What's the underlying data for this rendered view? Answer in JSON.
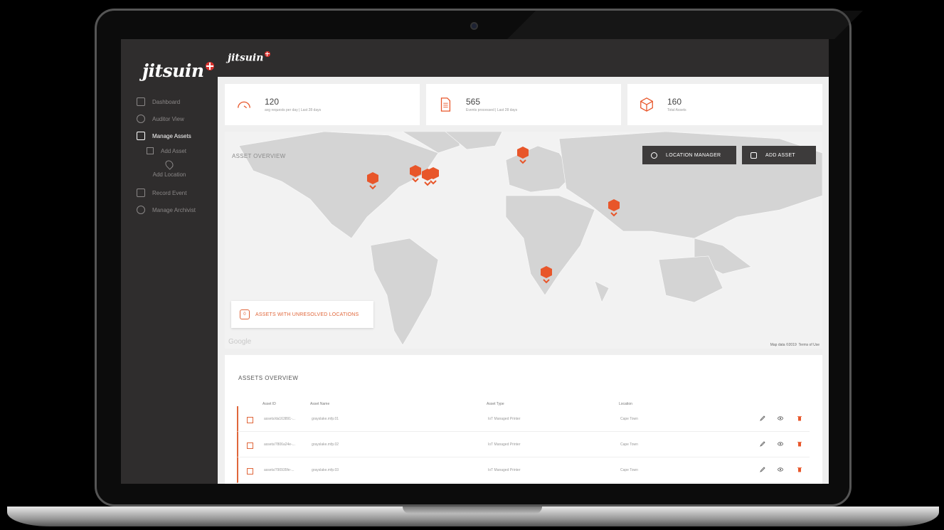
{
  "app": {
    "brand": "jitsuin"
  },
  "sidebar": {
    "items": [
      {
        "label": "Dashboard"
      },
      {
        "label": "Auditor View"
      },
      {
        "label": "Manage Assets"
      },
      {
        "label": "Add Asset"
      },
      {
        "label": "Add Location"
      },
      {
        "label": "Record Event"
      },
      {
        "label": "Manage Archivist"
      }
    ]
  },
  "stats": [
    {
      "value": "120",
      "label": "avg requests per day | Last 28 days",
      "icon": "gauge-icon"
    },
    {
      "value": "565",
      "label": "Events processed | Last 28 days",
      "icon": "document-icon"
    },
    {
      "value": "160",
      "label": "Total Assets",
      "icon": "box-icon"
    }
  ],
  "map": {
    "title": "ASSET OVERVIEW",
    "location_manager": "LOCATION MANAGER",
    "add_asset": "ADD ASSET",
    "unresolved_count": "0",
    "unresolved_label": "ASSETS WITH UNRESOLVED LOCATIONS",
    "watermark": "Google",
    "map_data": "Map data ©2019",
    "terms": "Terms of Use",
    "accent": "#e8562a"
  },
  "assets": {
    "title": "ASSETS OVERVIEW",
    "columns": [
      "Asset ID",
      "Asset Name",
      "Asset Type",
      "Location"
    ],
    "rows": [
      {
        "id": "assets/da163891-...",
        "name": "grayslake.mfp.01",
        "type": "IoT Managed Printer",
        "location": "Cape Town"
      },
      {
        "id": "assets/7806a24e-...",
        "name": "grayslake.mfp.02",
        "type": "IoT Managed Printer",
        "location": "Cape Town"
      },
      {
        "id": "assets/790935fe-...",
        "name": "grayslake.mfp.03",
        "type": "IoT Managed Printer",
        "location": "Cape Town"
      }
    ]
  }
}
